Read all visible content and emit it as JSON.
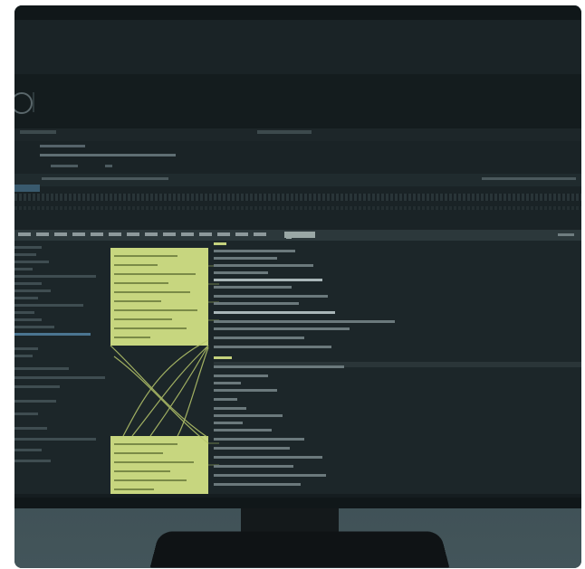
{
  "scene": {
    "description": "",
    "colors": {
      "screen_bg": "#1a2326",
      "note_yellow": "#c7d67f",
      "link_lines": "#b9c96c",
      "sidebar_highlight": "#4b7591",
      "frame_bg": "#3a4a4f"
    }
  },
  "ui_text": {
    "header_title": "",
    "toolbar_left": "",
    "toolbar_right": "",
    "status_left": "",
    "status_right": "",
    "tabs": [
      "",
      "",
      "",
      "",
      "",
      "",
      "",
      "",
      "",
      "",
      "",
      ""
    ],
    "bottom_items": [
      "",
      "",
      "",
      "",
      "",
      "",
      ""
    ],
    "bottom_right": ""
  }
}
